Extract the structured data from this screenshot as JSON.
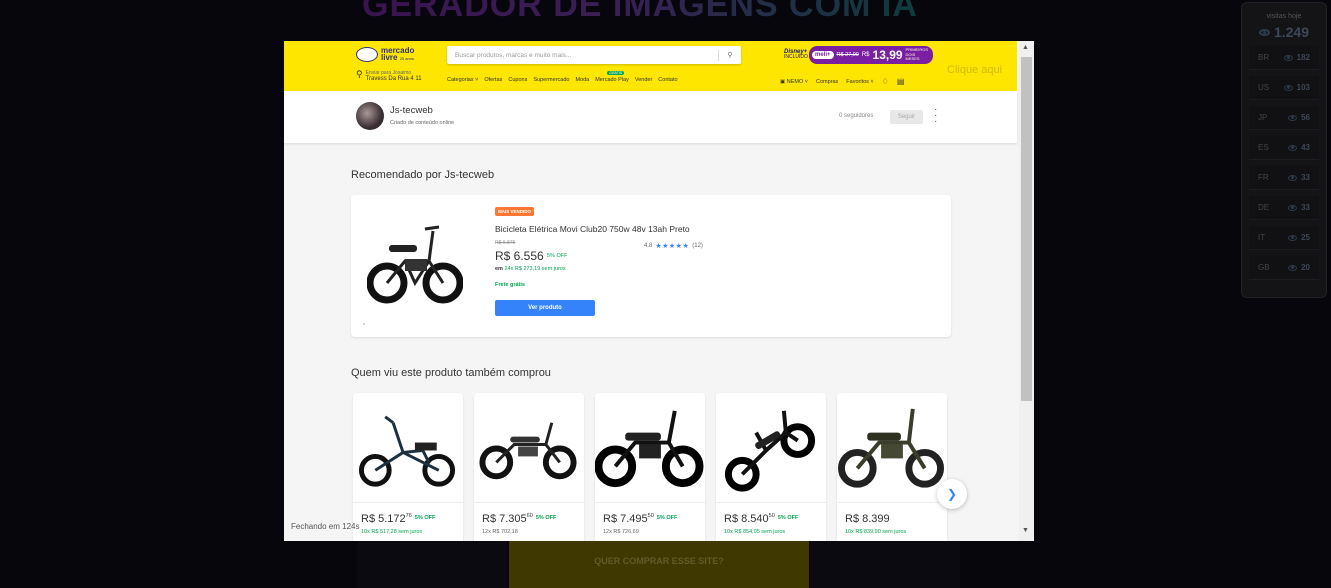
{
  "background": {
    "title": "GERADOR DE IMAGENS COM IA",
    "buy_button": "QUER COMPRAR ESSE SITE?",
    "click_hint": "Clique aqui",
    "stats": {
      "label": "visitas hoje",
      "total": "1.249",
      "rows": [
        {
          "c": "BR",
          "v": "182"
        },
        {
          "c": "US",
          "v": "103"
        },
        {
          "c": "JP",
          "v": "56"
        },
        {
          "c": "ES",
          "v": "43"
        },
        {
          "c": "FR",
          "v": "33"
        },
        {
          "c": "DE",
          "v": "33"
        },
        {
          "c": "IT",
          "v": "25"
        },
        {
          "c": "GB",
          "v": "20"
        }
      ]
    }
  },
  "header": {
    "logo_line1": "mercado",
    "logo_line2": "livre",
    "logo_badge": "25 anos",
    "search_placeholder": "Buscar produtos, marcas e muito mais...",
    "promo": {
      "disney": "Disney+",
      "disney_sub": "INCLUÍDO",
      "meli": "meli+",
      "old_price": "R$ 27,99",
      "currency": "R$",
      "new_price": "13,99",
      "note": "PRIMEIROS DOIS MESES"
    },
    "location_line1": "Enviar para Josaimo",
    "location_line2": "Travess Da Rua 4 11",
    "nav": [
      "Categorias",
      "Ofertas",
      "Cupons",
      "Supermercado",
      "Moda",
      "Mercado Play",
      "Vender",
      "Contato"
    ],
    "nav_badge": "GRÁTIS",
    "user": "NEMO",
    "right_nav": [
      "Compras",
      "Favoritos"
    ]
  },
  "profile": {
    "name": "Js-tecweb",
    "subtitle": "Criado de conteúdo online",
    "followers": "0 seguidores",
    "follow": "Seguir"
  },
  "section1": {
    "title": "Recomendado por Js-tecweb"
  },
  "featured": {
    "badge": "MAIS VENDIDO",
    "title": "Bicicleta Elétrica Movi Club20 750w 48v 13ah Preto",
    "original": "R$ 6.875",
    "price": "R$ 6.556",
    "off": "5% OFF",
    "installment_prefix": "em",
    "installment": "24x R$ 273,19 sem juros",
    "shipping": "Frete grátis",
    "button": "Ver produto",
    "rating": "4.8",
    "stars": "★★★★★",
    "reviews": "(12)"
  },
  "section2": {
    "title": "Quem viu este produto também comprou"
  },
  "products": [
    {
      "price": "R$ 5.172",
      "cents": "76",
      "off": "5% OFF",
      "inst": "10x R$ 517,28 sem juros",
      "green": true
    },
    {
      "price": "R$ 7.305",
      "cents": "60",
      "off": "5% OFF",
      "inst": "12x R$ 702,18",
      "green": false
    },
    {
      "price": "R$ 7.495",
      "cents": "50",
      "off": "5% OFF",
      "inst": "12x R$ 726,69",
      "green": false
    },
    {
      "price": "R$ 8.540",
      "cents": "50",
      "off": "5% OFF",
      "inst": "10x R$ 854,05 sem juros",
      "green": true
    },
    {
      "price": "R$ 8.399",
      "cents": "",
      "off": "",
      "inst": "10x R$ 839,90 sem juros",
      "green": true
    }
  ],
  "closing": "Fechando em 124s"
}
